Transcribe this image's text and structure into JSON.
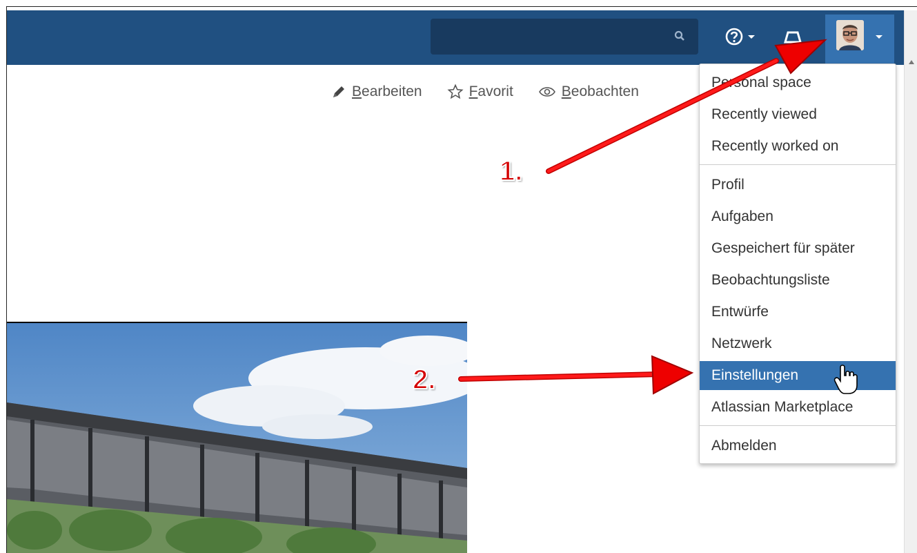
{
  "header": {
    "search": {
      "placeholder": ""
    },
    "help_icon": "help-circle-icon",
    "notifications_icon": "notification-bell-icon",
    "user_icon": "user-avatar",
    "brand_color": "#205081",
    "active_color": "#3572b0"
  },
  "page_actions": [
    {
      "icon": "pencil-icon",
      "first": "B",
      "rest": "earbeiten"
    },
    {
      "icon": "star-icon",
      "first": "F",
      "rest": "avorit"
    },
    {
      "icon": "eye-icon",
      "first": "B",
      "rest": "eobachten"
    }
  ],
  "user_menu": {
    "groups": [
      [
        "Personal space",
        "Recently viewed",
        "Recently worked on"
      ],
      [
        "Profil",
        "Aufgaben",
        "Gespeichert für später",
        "Beobachtungsliste",
        "Entwürfe",
        "Netzwerk",
        "Einstellungen",
        "Atlassian Marketplace"
      ],
      [
        "Abmelden"
      ]
    ],
    "highlighted": "Einstellungen"
  },
  "annotations": {
    "step1": "1.",
    "step2": "2.",
    "arrow_color": "#e00000"
  }
}
